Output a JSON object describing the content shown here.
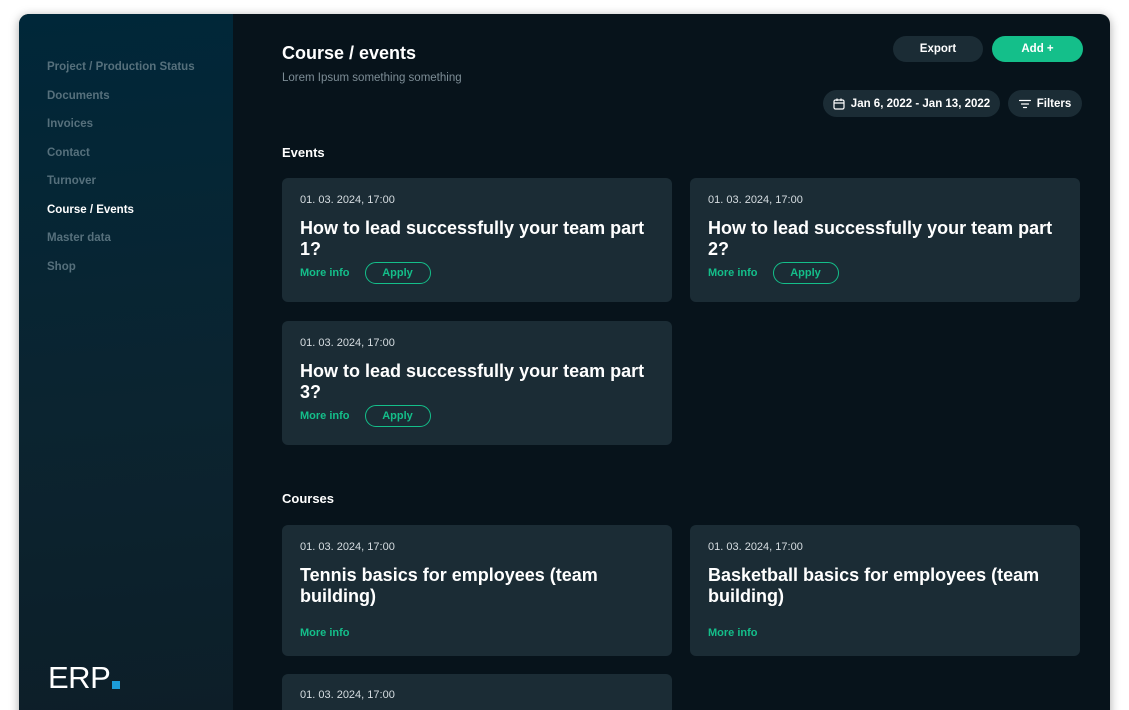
{
  "sidebar": {
    "items": [
      {
        "label": "Project / Production Status"
      },
      {
        "label": "Documents"
      },
      {
        "label": "Invoices"
      },
      {
        "label": "Contact"
      },
      {
        "label": "Turnover"
      },
      {
        "label": "Course / Events",
        "active": true
      },
      {
        "label": "Master data"
      },
      {
        "label": "Shop"
      }
    ],
    "logo": "ERP"
  },
  "header": {
    "title": "Course / events",
    "subtitle": "Lorem Ipsum something something",
    "export_label": "Export",
    "add_label": "Add +",
    "date_range": "Jan 6, 2022 - Jan 13, 2022",
    "filters_label": "Filters"
  },
  "events": {
    "title": "Events",
    "cards": [
      {
        "date": "01. 03. 2024, 17:00",
        "title": "How to lead successfully your team part 1?",
        "more": "More info",
        "apply": "Apply"
      },
      {
        "date": "01. 03. 2024, 17:00",
        "title": "How to lead successfully your team part 2?",
        "more": "More info",
        "apply": "Apply"
      },
      {
        "date": "01. 03. 2024, 17:00",
        "title": "How to lead successfully your team part 3?",
        "more": "More info",
        "apply": "Apply"
      }
    ]
  },
  "courses": {
    "title": "Courses",
    "cards": [
      {
        "date": "01. 03. 2024, 17:00",
        "title": "Tennis basics for employees (team building)",
        "more": "More info"
      },
      {
        "date": "01. 03. 2024, 17:00",
        "title": "Basketball basics for employees (team building)",
        "more": "More info"
      },
      {
        "date": "01. 03. 2024, 17:00"
      }
    ]
  },
  "colors": {
    "accent": "#14bf8a",
    "background": "#07131b",
    "card": "#1b2c35",
    "logo_dot": "#1c9cd8"
  },
  "icons": {
    "date": "calendar-icon",
    "filters": "filter-icon"
  }
}
